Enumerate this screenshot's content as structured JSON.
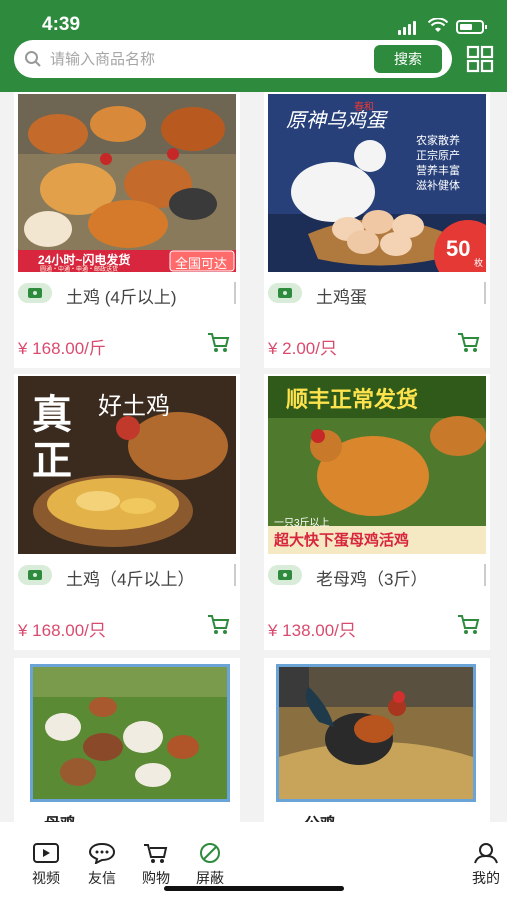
{
  "status": {
    "time": "4:39"
  },
  "search": {
    "placeholder": "请输入商品名称",
    "button": "搜索"
  },
  "products": [
    {
      "name": "土鸡 (4斤以上)",
      "price": "¥ 168.00/斤",
      "banner": "24小时~闪电发货",
      "badge": "全国可达",
      "subtext": "圆通・中通・申通・邮政送货"
    },
    {
      "name": "土鸡蛋",
      "price": "¥ 2.00/只",
      "title": "原神乌鸡蛋",
      "small": "春和",
      "features": [
        "农家散养",
        "正宗原产",
        "营养丰富",
        "滋补健体"
      ],
      "count": "50",
      "unit": "枚"
    },
    {
      "name": "土鸡（4斤以上）",
      "price": "¥ 168.00/只",
      "big1": "真",
      "big2": "正",
      "slogan": "好土鸡"
    },
    {
      "name": "老母鸡（3斤）",
      "price": "¥ 138.00/只",
      "top": "顺丰正常发货",
      "note": "一只3斤以上",
      "bottom": "超大快下蛋母鸡活鸡"
    },
    {
      "name": "母鸡"
    },
    {
      "name": "公鸡"
    }
  ],
  "tabs": [
    {
      "label": "视频",
      "icon": "video-icon"
    },
    {
      "label": "友信",
      "icon": "chat-icon"
    },
    {
      "label": "购物",
      "icon": "cart-icon"
    },
    {
      "label": "屏蔽",
      "icon": "block-icon"
    },
    {
      "label": "我的",
      "icon": "user-icon"
    }
  ],
  "colors": {
    "primary": "#2e8b3e",
    "price": "#d94b6e"
  }
}
